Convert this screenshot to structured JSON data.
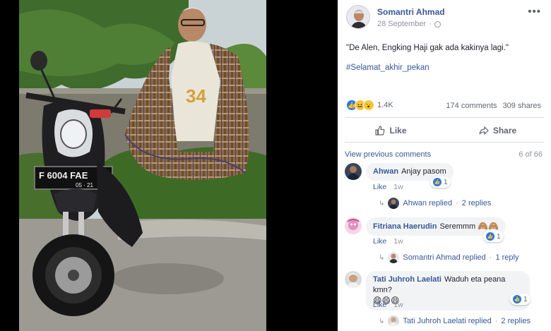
{
  "post": {
    "author": "Somantri Ahmad",
    "date": "28 September",
    "more": "•••",
    "text": "\"De Alen, Engking Haji gak ada kakinya lagi.\"",
    "hashtag": "#Selamat_akhir_pekan",
    "reaction_count": "1.4K",
    "comments_count": "174 comments",
    "shares_count": "309 shares",
    "reactions": [
      "like",
      "haha",
      "wow"
    ]
  },
  "actions": {
    "like_label": "Like",
    "share_label": "Share"
  },
  "comments_header": {
    "view_previous": "View previous comments",
    "page": "6 of 66"
  },
  "comments": [
    {
      "name": "Ahwan",
      "text": "Anjay pasom",
      "like_label": "Like",
      "time": "1w",
      "reactions": "1",
      "reply_by": "Ahwan replied",
      "reply_count": "2 replies"
    },
    {
      "name": "Fitriana Haerudin",
      "text": "Seremmm",
      "emoji": "🙈🙈",
      "like_label": "Like",
      "time": "1w",
      "reactions": "1",
      "reply_by": "Somantri Ahmad replied",
      "reply_count": "1 reply"
    },
    {
      "name": "Tati Juhroh Laelati",
      "text": "Waduh eta peana kmn?",
      "emoji": "😄😄😄",
      "like_label": "Like",
      "time": "1w",
      "reactions": "1",
      "reply_by": "Tati Juhroh Laelati replied",
      "reply_count": "2 replies"
    }
  ],
  "photo": {
    "plate_top": "F 6004 FAE",
    "plate_bottom": "05 · 21"
  },
  "colors": {
    "link": "#385898",
    "like_blue": "#2078f4",
    "sarong_brown": "#8a6a45"
  }
}
